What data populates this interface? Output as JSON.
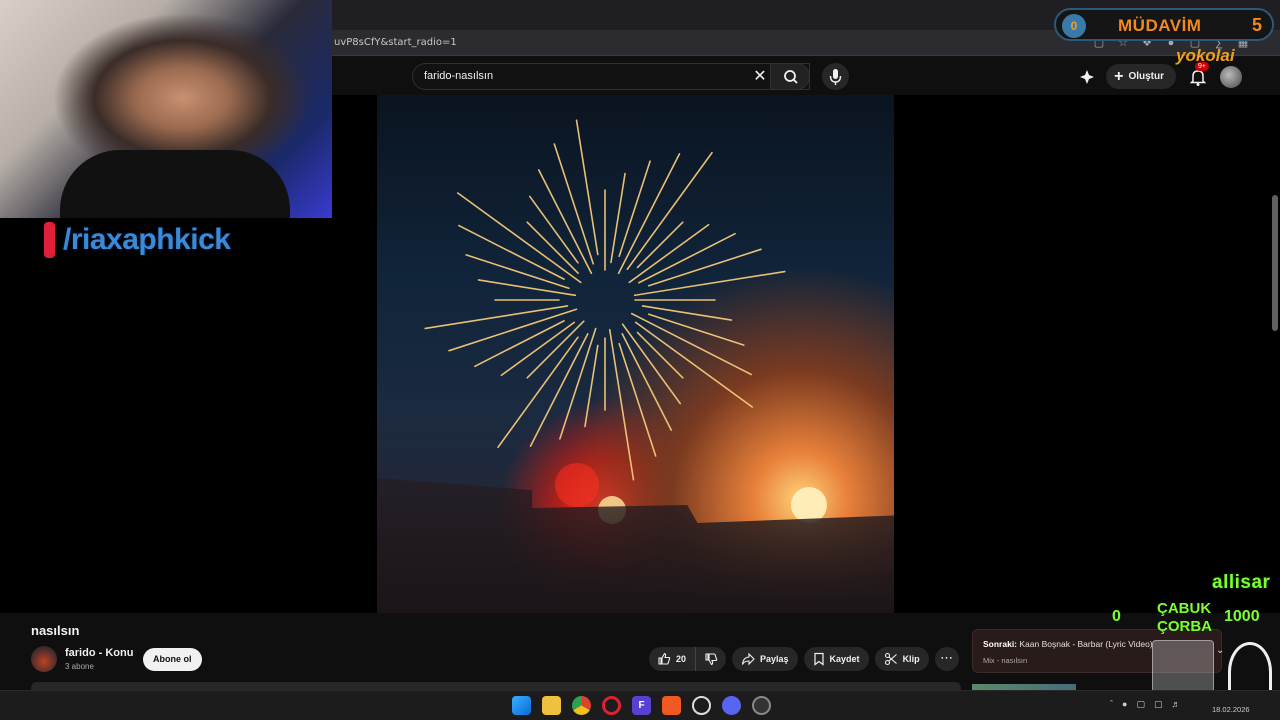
{
  "browser": {
    "url_fragment": "uvP8sCfY&start_radio=1"
  },
  "header": {
    "search_value": "farido-nasılsın",
    "create_label": "Oluştur",
    "notification_badge": "9+"
  },
  "overlay": {
    "kick_handle": "/riaxaphkick",
    "mudavim_label": "MÜDAVİM",
    "mudavim_coin": "0",
    "mudavim_count": "5",
    "yokolai": "yokolai",
    "allisar": "allisar",
    "zero": "0",
    "cabuk_corba": "ÇABUK ÇORBA",
    "thousand": "1000"
  },
  "video": {
    "title": "nasılsın",
    "channel_name": "farido - Konu",
    "subscribers": "3 abone",
    "subscribe_label": "Abone ol",
    "like_count": "20",
    "share_label": "Paylaş",
    "save_label": "Kaydet",
    "clip_label": "Klip"
  },
  "up_next": {
    "prefix": "Sonraki:",
    "title": "Kaan Boşnak - Barbar (Lyric Video)",
    "subtitle": "Mix - nasılsın"
  },
  "taskbar": {
    "date": "18.02.2026"
  },
  "colors": {
    "kick_red": "#e0203a",
    "overlay_green": "#7aff30",
    "mudavim_orange": "#f08a20"
  }
}
